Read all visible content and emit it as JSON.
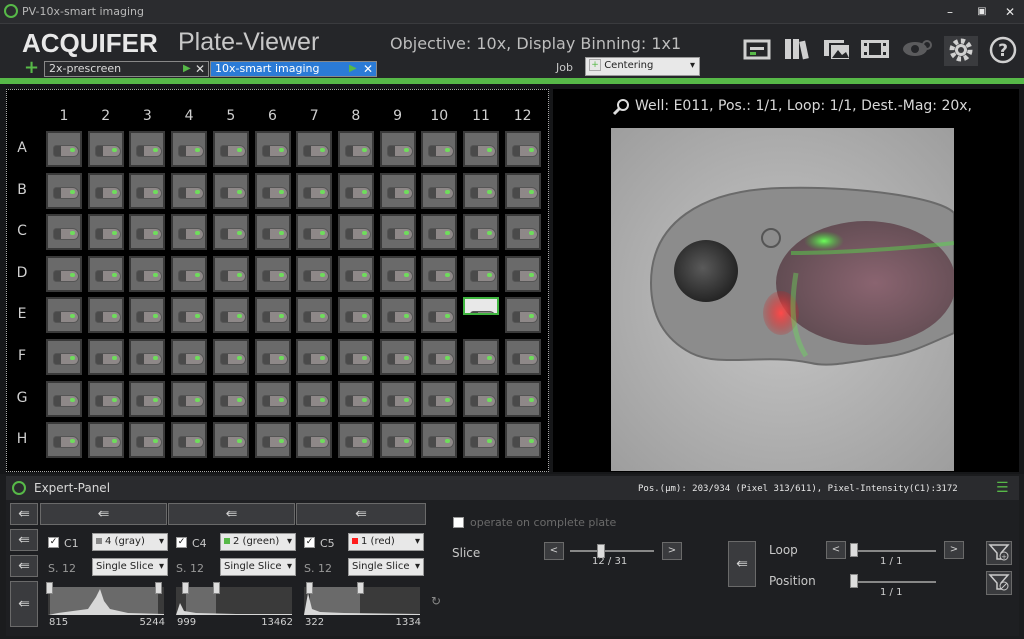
{
  "window": {
    "title": "PV-10x-smart imaging"
  },
  "header": {
    "logo": "ACQUIFER",
    "app_name": "Plate-Viewer",
    "objective": "Objective: 10x, Display Binning: 1x1",
    "tabs": [
      {
        "label": "2x-prescreen"
      },
      {
        "label": "10x-smart imaging"
      }
    ],
    "job_label": "Job",
    "job_value": "Centering"
  },
  "plate": {
    "columns": [
      "1",
      "2",
      "3",
      "4",
      "5",
      "6",
      "7",
      "8",
      "9",
      "10",
      "11",
      "12"
    ],
    "rows": [
      "A",
      "B",
      "C",
      "D",
      "E",
      "F",
      "G",
      "H"
    ],
    "selected_well": "E11"
  },
  "viewer": {
    "well_info": "Well: E011, Pos.: 1/1, Loop: 1/1, Dest.-Mag: 20x,"
  },
  "expert": {
    "title": "Expert-Panel",
    "status": "Pos.(µm): 203/934 (Pixel 313/611), Pixel-Intensity(C1):3172",
    "channels": [
      {
        "label": "C1",
        "lut": "4 (gray)",
        "slice_label": "S. 12",
        "mode": "Single Slice",
        "min": "815",
        "max": "5244"
      },
      {
        "label": "C4",
        "lut": "2 (green)",
        "slice_label": "S. 12",
        "mode": "Single Slice",
        "min": "999",
        "max": "13462"
      },
      {
        "label": "C5",
        "lut": "1 (red)",
        "slice_label": "S. 12",
        "mode": "Single Slice",
        "min": "322",
        "max": "1334"
      }
    ],
    "operate_label": "operate on complete plate",
    "slice_label": "Slice",
    "slice_value": "12 / 31",
    "loop_label": "Loop",
    "loop_value": "1 / 1",
    "position_label": "Position",
    "position_value": "1 / 1",
    "colors": {
      "green": "#57b948",
      "red": "#ff1c1c",
      "gray": "#888888"
    }
  }
}
